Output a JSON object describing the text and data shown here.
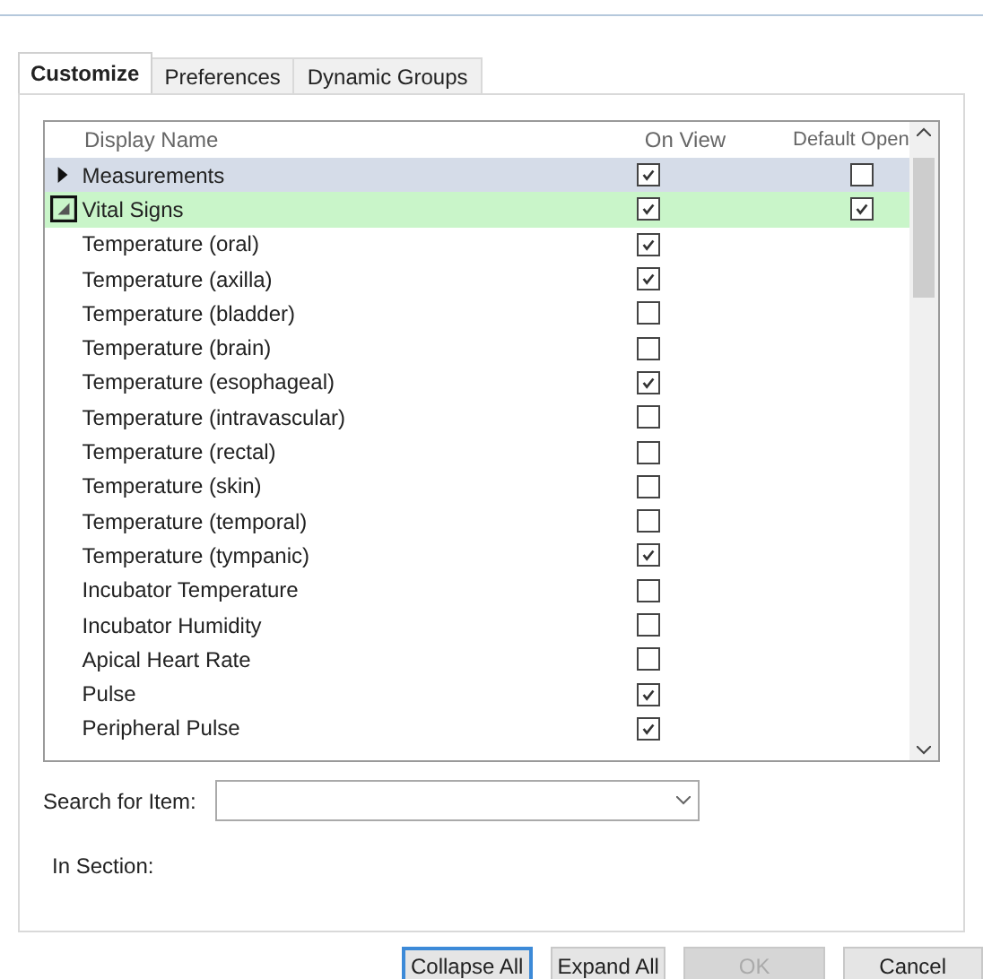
{
  "tabs": [
    {
      "label": "Customize",
      "selected": true
    },
    {
      "label": "Preferences",
      "selected": false
    },
    {
      "label": "Dynamic Groups",
      "selected": false
    }
  ],
  "list": {
    "columns": [
      "Display Name",
      "On View",
      "Default Open"
    ],
    "rows": [
      {
        "name": "Measurements",
        "expanded": false,
        "color": "#d5dce8",
        "on_view": true,
        "default_open": false
      },
      {
        "name": "Vital Signs",
        "expanded": true,
        "color": "#c9f5c9",
        "on_view": true,
        "default_open": true,
        "children": [
          {
            "name": "Temperature (oral)",
            "on_view": true
          },
          {
            "name": "Temperature (axilla)",
            "on_view": true
          },
          {
            "name": "Temperature (bladder)",
            "on_view": false
          },
          {
            "name": "Temperature (brain)",
            "on_view": false
          },
          {
            "name": "Temperature (esophageal)",
            "on_view": true
          },
          {
            "name": "Temperature (intravascular)",
            "on_view": false
          },
          {
            "name": "Temperature (rectal)",
            "on_view": false
          },
          {
            "name": "Temperature (skin)",
            "on_view": false
          },
          {
            "name": "Temperature (temporal)",
            "on_view": false
          },
          {
            "name": "Temperature (tympanic)",
            "on_view": true
          },
          {
            "name": "Incubator Temperature",
            "on_view": false
          },
          {
            "name": "Incubator Humidity",
            "on_view": false
          },
          {
            "name": "Apical Heart Rate",
            "on_view": false
          },
          {
            "name": "Pulse",
            "on_view": true
          },
          {
            "name": "Peripheral Pulse",
            "on_view": true
          }
        ]
      }
    ]
  },
  "search": {
    "label": "Search for Item:"
  },
  "section": {
    "label": "In Section:"
  },
  "buttons": [
    {
      "label": "Collapse All",
      "focused": true,
      "disabled": false
    },
    {
      "label": "Expand All",
      "focused": false,
      "disabled": false
    },
    {
      "label": "OK",
      "focused": false,
      "disabled": true
    },
    {
      "label": "Cancel",
      "focused": false,
      "disabled": false
    }
  ]
}
